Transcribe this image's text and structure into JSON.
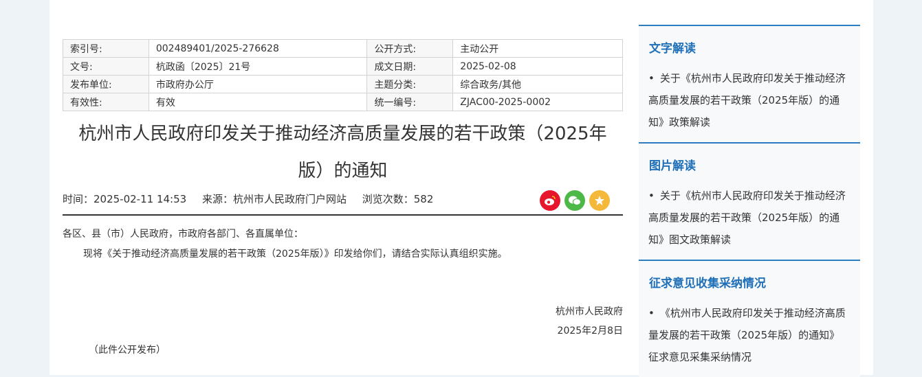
{
  "info_table": {
    "rows": [
      {
        "k1": "索引号:",
        "v1": "002489401/2025-276628",
        "k2": "公开方式:",
        "v2": "主动公开"
      },
      {
        "k1": "文号:",
        "v1": "杭政函〔2025〕21号",
        "k2": "成文日期:",
        "v2": "2025-02-08"
      },
      {
        "k1": "发布单位:",
        "v1": "市政府办公厅",
        "k2": "主题分类:",
        "v2": "综合政务/其他"
      },
      {
        "k1": "有效性:",
        "v1": "有效",
        "k2": "统一编号:",
        "v2": "ZJAC00-2025-0002"
      }
    ]
  },
  "article": {
    "title_line1": "杭州市人民政府印发关于推动经济高质量发展的若干政策（2025年",
    "title_line2": "版）的通知",
    "meta": {
      "time": "时间：2025-02-11 14:53",
      "source": "来源：杭州市人民政府门户网站",
      "views": "浏览次数：582"
    },
    "greeting": "各区、县（市）人民政府，市政府各部门、各直属单位：",
    "paragraph": "现将《关于推动经济高质量发展的若干政策（2025年版）》印发给你们，请结合实际认真组织实施。",
    "signature": "杭州市人民政府",
    "sign_date": "2025年2月8日",
    "note": "（此件公开发布）"
  },
  "share": {
    "icons": [
      "weibo-icon",
      "wechat-icon",
      "favorite-icon"
    ]
  },
  "sidebar": {
    "blocks": [
      {
        "heading": "文字解读",
        "link": "关于《杭州市人民政府印发关于推动经济高质量发展的若干政策（2025年版）的通知》政策解读"
      },
      {
        "heading": "图片解读",
        "link": "关于《杭州市人民政府印发关于推动经济高质量发展的若干政策（2025年版）的通知》图文政策解读"
      },
      {
        "heading": "征求意见收集采纳情况",
        "link": "《杭州市人民政府印发关于推动经济高质量发展的若干政策（2025年版）的通知》征求意见采集采纳情况"
      }
    ]
  },
  "colors": {
    "accent": "#1f6fb7",
    "rule": "#333333",
    "weibo": "#e6162d",
    "wechat": "#4cb848",
    "favorite": "#f4b83a"
  }
}
